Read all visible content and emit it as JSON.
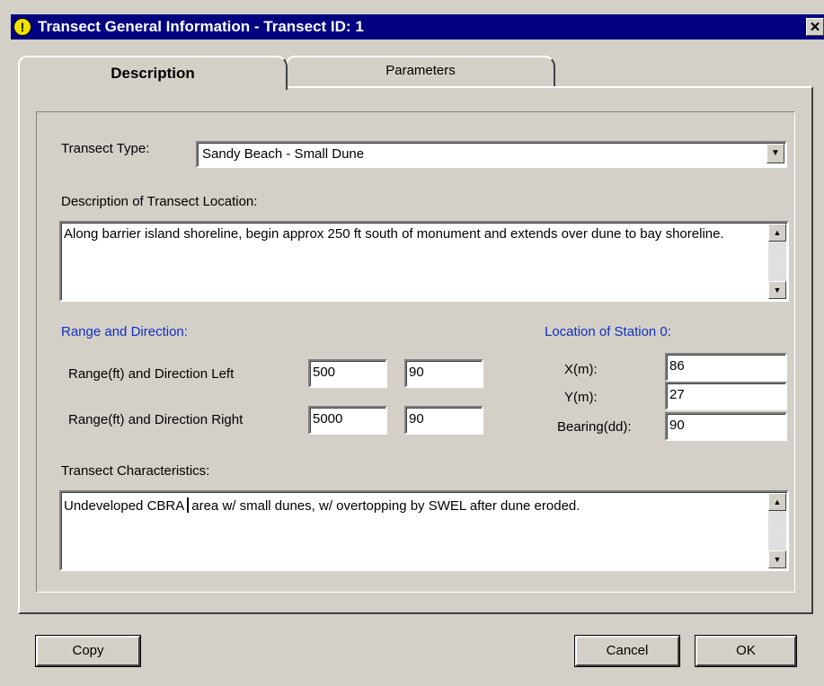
{
  "window": {
    "title": "Transect General Information - Transect ID: 1",
    "title_icon": "!",
    "close_symbol": "✕"
  },
  "tabs": [
    {
      "label": "Description",
      "active": true
    },
    {
      "label": "Parameters",
      "active": false
    }
  ],
  "transect_type": {
    "label": "Transect Type:",
    "value": "Sandy Beach - Small Dune",
    "arrow": "▼"
  },
  "location_description": {
    "label": "Description of Transect Location:",
    "value": "Along barrier island shoreline, begin approx 250 ft south of  monument  and extends over dune to  bay shoreline."
  },
  "range_direction": {
    "heading": "Range and Direction:",
    "left_label": "Range(ft) and Direction Left",
    "left_range": "500",
    "left_direction": "90",
    "right_label": "Range(ft) and Direction Right",
    "right_range": "5000",
    "right_direction": "90"
  },
  "station0": {
    "heading": "Location of Station 0:",
    "x_label": "X(m):",
    "x_value": "86",
    "y_label": "Y(m):",
    "y_value": "27",
    "bearing_label": "Bearing(dd):",
    "bearing_value": "90"
  },
  "characteristics": {
    "label": "Transect Characteristics:",
    "value_before_caret": "Undeveloped CBRA",
    "value_after_caret": "area w/ small dunes, w/ overtopping by SWEL after dune eroded."
  },
  "scroll_arrows": {
    "up": "▲",
    "down": "▼"
  },
  "buttons": {
    "copy": "Copy",
    "cancel": "Cancel",
    "ok": "OK"
  },
  "colors": {
    "titlebar": "#000080",
    "face": "#d4d0c8",
    "section_heading": "#1030c0"
  }
}
